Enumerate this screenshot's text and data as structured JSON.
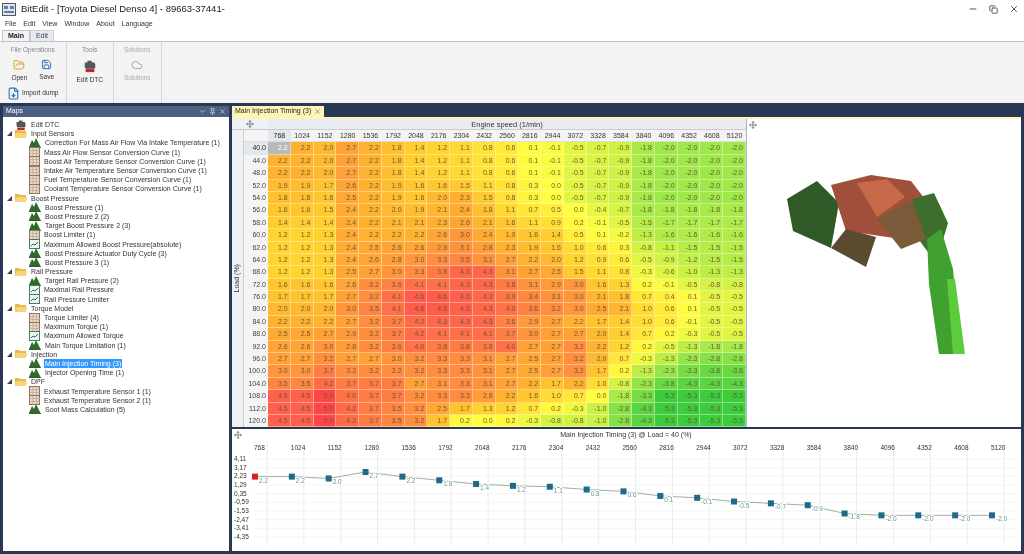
{
  "window": {
    "title": "BitEdit - [Toyota Diesel Denso 4] - 89663-37441-"
  },
  "menu": [
    "File",
    "Edit",
    "View",
    "Window",
    "About",
    "Language"
  ],
  "ribbon_tabs": [
    {
      "label": "Main",
      "selected": true
    },
    {
      "label": "Edit",
      "selected": false
    }
  ],
  "ribbon_groups": [
    {
      "title": "File Operations",
      "disabled": false,
      "buttons": [
        {
          "label": "Open",
          "kind": "open",
          "disabled": false
        },
        {
          "label": "Save",
          "kind": "save",
          "disabled": false
        }
      ],
      "wide_button": {
        "label": "Import dump",
        "kind": "import",
        "disabled": false
      }
    },
    {
      "title": "Tools",
      "disabled": false,
      "buttons": [
        {
          "label": "Edit DTC",
          "kind": "dtc",
          "disabled": false
        }
      ]
    },
    {
      "title": "Solutions",
      "disabled": true,
      "buttons": [
        {
          "label": "Solutions",
          "kind": "cloud",
          "disabled": true
        }
      ]
    }
  ],
  "maps_panel": {
    "title": "Maps",
    "tree": [
      {
        "label": "Edit DTC",
        "kind": "dtc",
        "selected": false
      },
      {
        "label": "Input Sensors",
        "kind": "folder",
        "expanded": true,
        "selected": false,
        "children": [
          {
            "label": "Correction For Mass Air Flow Via Intake Temperature (1)",
            "kind": "map3d",
            "selected": false
          },
          {
            "label": "Mass Air Flow Sensor Conversion Curve (1)",
            "kind": "table",
            "selected": false
          },
          {
            "label": "Boost Air Temperature Sensor Conversion Curve (1)",
            "kind": "table",
            "selected": false
          },
          {
            "label": "Intake Air Temperature Sensor Conversion Curve (1)",
            "kind": "table",
            "selected": false
          },
          {
            "label": "Fuel Temperature Sensor Conversion Curve (1)",
            "kind": "table",
            "selected": false
          },
          {
            "label": "Coolant Temperature Sensor Conversion Curve (1)",
            "kind": "table",
            "selected": false
          }
        ]
      },
      {
        "label": "Boost Pressure",
        "kind": "folder",
        "expanded": true,
        "selected": false,
        "children": [
          {
            "label": "Boost Pressure (1)",
            "kind": "map3d",
            "selected": false
          },
          {
            "label": "Boost Pressure 2 (2)",
            "kind": "map3d",
            "selected": false
          },
          {
            "label": "Target Boost Pressure 2 (3)",
            "kind": "map3d",
            "selected": false
          },
          {
            "label": "Boost Limiter (1)",
            "kind": "table",
            "selected": false
          },
          {
            "label": "Maximum Allowed Boost Pressure(absolute)",
            "kind": "curve",
            "selected": false
          },
          {
            "label": "Boost Pressure Actuator Duty Cycle (3)",
            "kind": "map3d",
            "selected": false
          },
          {
            "label": "Boost Pressure 3 (1)",
            "kind": "map3d",
            "selected": false
          }
        ]
      },
      {
        "label": "Rail Pressure",
        "kind": "folder",
        "expanded": true,
        "selected": false,
        "children": [
          {
            "label": "Target Rail Pressure (2)",
            "kind": "map3d",
            "selected": false
          },
          {
            "label": "Maximal Rail Pressure",
            "kind": "curve",
            "selected": false
          },
          {
            "label": "Rail Pressure Limiter",
            "kind": "curve",
            "selected": false
          }
        ]
      },
      {
        "label": "Torque Model",
        "kind": "folder",
        "expanded": true,
        "selected": false,
        "children": [
          {
            "label": "Torque Limiter (4)",
            "kind": "table",
            "selected": false
          },
          {
            "label": "Maximum Torque (1)",
            "kind": "table",
            "selected": false
          },
          {
            "label": "Maximum Allowed Torque",
            "kind": "curve",
            "selected": false
          },
          {
            "label": "Main Torque Limitation (1)",
            "kind": "map3d",
            "selected": false
          }
        ]
      },
      {
        "label": "Injection",
        "kind": "folder",
        "expanded": true,
        "selected": false,
        "children": [
          {
            "label": "Main Injection Timing (3)",
            "kind": "map3d",
            "selected": true
          },
          {
            "label": "Injector Opening Time (1)",
            "kind": "map3d",
            "selected": false
          }
        ]
      },
      {
        "label": "DPF",
        "kind": "folder",
        "expanded": true,
        "selected": false,
        "children": [
          {
            "label": "Exhaust Temperature Sensor 1 (1)",
            "kind": "table",
            "selected": false
          },
          {
            "label": "Exhaust Temperature Sensor 2 (1)",
            "kind": "table",
            "selected": false
          },
          {
            "label": "Soot Mass Calculation (5)",
            "kind": "map3d",
            "selected": false
          }
        ]
      }
    ]
  },
  "document_tabs": [
    {
      "label": "Main Injection Timing (3)",
      "selected": true
    }
  ],
  "table": {
    "x_title": "Engine speed (1/min)",
    "y_title": "Load (%)",
    "columns": [
      {
        "label": "768",
        "selected": true
      },
      {
        "label": "1024",
        "selected": false
      },
      {
        "label": "1152",
        "selected": false
      },
      {
        "label": "1280",
        "selected": false
      },
      {
        "label": "1536",
        "selected": false
      },
      {
        "label": "1792",
        "selected": false
      },
      {
        "label": "2048",
        "selected": false
      },
      {
        "label": "2176",
        "selected": false
      },
      {
        "label": "2304",
        "selected": false
      },
      {
        "label": "2432",
        "selected": false
      },
      {
        "label": "2560",
        "selected": false
      },
      {
        "label": "2816",
        "selected": false
      },
      {
        "label": "2944",
        "selected": false
      },
      {
        "label": "3072",
        "selected": false
      },
      {
        "label": "3328",
        "selected": false
      },
      {
        "label": "3584",
        "selected": false
      },
      {
        "label": "3840",
        "selected": false
      },
      {
        "label": "4096",
        "selected": false
      },
      {
        "label": "4352",
        "selected": false
      },
      {
        "label": "4608",
        "selected": false
      },
      {
        "label": "5120",
        "selected": false
      }
    ],
    "rows": [
      {
        "label": "40.0",
        "selected": true,
        "cells": [
          "2.2",
          "2.2",
          "2.0",
          "2.7",
          "2.2",
          "1.8",
          "1.4",
          "1.2",
          "1.1",
          "0.8",
          "0.6",
          "0.1",
          "-0.1",
          "-0.5",
          "-0.7",
          "-0.9",
          "-1.8",
          "-2.0",
          "-2.0",
          "-2.0",
          "-2.0"
        ]
      },
      {
        "label": "44.0",
        "selected": false,
        "cells": [
          "2.2",
          "2.2",
          "2.0",
          "2.7",
          "2.2",
          "1.8",
          "1.4",
          "1.2",
          "1.1",
          "0.8",
          "0.6",
          "0.1",
          "-0.1",
          "-0.5",
          "-0.7",
          "-0.9",
          "-1.8",
          "-2.0",
          "-2.0",
          "-2.0",
          "-2.0"
        ]
      },
      {
        "label": "48.0",
        "selected": false,
        "cells": [
          "2.2",
          "2.2",
          "2.0",
          "2.7",
          "2.2",
          "1.8",
          "1.4",
          "1.2",
          "1.1",
          "0.8",
          "0.6",
          "0.1",
          "-0.1",
          "-0.5",
          "-0.7",
          "-0.9",
          "-1.8",
          "-2.0",
          "-2.0",
          "-2.0",
          "-2.0"
        ]
      },
      {
        "label": "52.0",
        "selected": false,
        "cells": [
          "1.9",
          "1.9",
          "1.7",
          "2.6",
          "2.2",
          "1.9",
          "1.6",
          "1.6",
          "1.5",
          "1.1",
          "0.8",
          "0.3",
          "0.0",
          "-0.5",
          "-0.7",
          "-0.9",
          "-1.8",
          "-2.0",
          "-2.0",
          "-2.0",
          "-2.0"
        ]
      },
      {
        "label": "54.0",
        "selected": false,
        "cells": [
          "1.8",
          "1.8",
          "1.6",
          "2.5",
          "2.2",
          "1.9",
          "1.6",
          "2.0",
          "2.3",
          "1.5",
          "0.8",
          "0.3",
          "0.0",
          "-0.5",
          "-0.7",
          "-0.9",
          "-1.8",
          "-2.0",
          "-2.0",
          "-2.0",
          "-2.0"
        ]
      },
      {
        "label": "56.0",
        "selected": false,
        "cells": [
          "1.6",
          "1.6",
          "1.5",
          "2.4",
          "2.2",
          "2.0",
          "1.9",
          "2.1",
          "2.4",
          "1.8",
          "1.1",
          "0.7",
          "0.5",
          "0.0",
          "-0.4",
          "-0.7",
          "-1.8",
          "-1.8",
          "-1.8",
          "-1.8",
          "-1.8"
        ]
      },
      {
        "label": "58.0",
        "selected": false,
        "cells": [
          "1.4",
          "1.4",
          "1.4",
          "2.4",
          "2.2",
          "2.1",
          "2.1",
          "2.3",
          "2.6",
          "2.1",
          "1.6",
          "1.1",
          "0.9",
          "0.2",
          "-0.1",
          "-0.5",
          "-1.5",
          "-1.7",
          "-1.7",
          "-1.7",
          "-1.7"
        ]
      },
      {
        "label": "60.0",
        "selected": false,
        "cells": [
          "1.2",
          "1.2",
          "1.3",
          "2.4",
          "2.2",
          "2.2",
          "2.2",
          "2.6",
          "3.0",
          "2.4",
          "1.9",
          "1.6",
          "1.4",
          "0.5",
          "0.1",
          "-0.2",
          "-1.3",
          "-1.6",
          "-1.6",
          "-1.6",
          "-1.6"
        ]
      },
      {
        "label": "62.0",
        "selected": false,
        "cells": [
          "1.2",
          "1.2",
          "1.3",
          "2.4",
          "2.5",
          "2.6",
          "2.6",
          "2.9",
          "3.1",
          "2.8",
          "2.3",
          "1.9",
          "1.6",
          "1.0",
          "0.6",
          "0.3",
          "-0.8",
          "-1.1",
          "-1.5",
          "-1.5",
          "-1.5"
        ]
      },
      {
        "label": "64.0",
        "selected": false,
        "cells": [
          "1.2",
          "1.2",
          "1.3",
          "2.4",
          "2.6",
          "2.8",
          "3.0",
          "3.3",
          "3.5",
          "3.1",
          "2.7",
          "2.2",
          "2.0",
          "1.2",
          "0.9",
          "0.6",
          "-0.5",
          "-0.9",
          "-1.2",
          "-1.5",
          "-1.5"
        ]
      },
      {
        "label": "68.0",
        "selected": false,
        "cells": [
          "1.2",
          "1.2",
          "1.3",
          "2.5",
          "2.7",
          "3.0",
          "3.3",
          "3.8",
          "4.3",
          "4.3",
          "3.1",
          "2.7",
          "2.5",
          "1.5",
          "1.1",
          "0.8",
          "-0.3",
          "-0.6",
          "-1.0",
          "-1.3",
          "-1.3"
        ]
      },
      {
        "label": "72.0",
        "selected": false,
        "cells": [
          "1.6",
          "1.6",
          "1.6",
          "2.6",
          "3.2",
          "3.6",
          "4.1",
          "4.1",
          "4.3",
          "4.3",
          "3.8",
          "3.1",
          "2.9",
          "3.0",
          "1.6",
          "1.3",
          "0.2",
          "-0.1",
          "-0.5",
          "-0.8",
          "-0.8"
        ]
      },
      {
        "label": "76.0",
        "selected": false,
        "cells": [
          "1.7",
          "1.7",
          "1.7",
          "2.7",
          "3.2",
          "4.1",
          "4.6",
          "4.6",
          "4.5",
          "4.3",
          "3.9",
          "3.4",
          "3.1",
          "3.0",
          "2.1",
          "1.8",
          "0.7",
          "0.4",
          "0.1",
          "-0.5",
          "-0.5"
        ]
      },
      {
        "label": "80.0",
        "selected": false,
        "cells": [
          "2.0",
          "2.0",
          "2.0",
          "3.0",
          "3.5",
          "4.1",
          "4.6",
          "4.6",
          "4.5",
          "4.3",
          "4.0",
          "3.6",
          "3.2",
          "3.0",
          "2.5",
          "2.1",
          "1.0",
          "0.6",
          "0.1",
          "-0.5",
          "-0.5"
        ]
      },
      {
        "label": "84.0",
        "selected": false,
        "cells": [
          "2.2",
          "2.2",
          "2.2",
          "2.7",
          "3.2",
          "3.7",
          "4.2",
          "4.3",
          "4.3",
          "4.3",
          "3.6",
          "2.9",
          "2.7",
          "2.2",
          "1.7",
          "1.4",
          "1.0",
          "0.6",
          "-0.1",
          "-0.5",
          "-0.5"
        ]
      },
      {
        "label": "88.0",
        "selected": false,
        "cells": [
          "2.5",
          "2.5",
          "2.7",
          "2.9",
          "3.2",
          "3.7",
          "4.2",
          "4.1",
          "4.1",
          "4.1",
          "3.7",
          "3.0",
          "2.7",
          "2.7",
          "2.0",
          "1.4",
          "0.7",
          "0.2",
          "-0.3",
          "-0.5",
          "-0.5"
        ]
      },
      {
        "label": "92.0",
        "selected": false,
        "cells": [
          "2.6",
          "2.6",
          "3.0",
          "2.8",
          "3.2",
          "3.6",
          "4.0",
          "3.8",
          "3.8",
          "3.8",
          "4.0",
          "2.7",
          "2.7",
          "3.2",
          "2.2",
          "1.2",
          "0.2",
          "-0.5",
          "-1.3",
          "-1.8",
          "-1.8"
        ]
      },
      {
        "label": "96.0",
        "selected": false,
        "cells": [
          "2.7",
          "2.7",
          "3.2",
          "2.7",
          "2.7",
          "3.0",
          "3.2",
          "3.3",
          "3.3",
          "3.1",
          "2.7",
          "2.5",
          "2.7",
          "3.2",
          "2.0",
          "0.7",
          "-0.3",
          "-1.3",
          "-2.3",
          "-2.8",
          "-2.8"
        ]
      },
      {
        "label": "100.0",
        "selected": false,
        "cells": [
          "3.0",
          "3.0",
          "3.7",
          "3.2",
          "3.2",
          "3.2",
          "3.2",
          "3.3",
          "3.3",
          "3.1",
          "2.7",
          "2.5",
          "2.7",
          "3.2",
          "1.7",
          "0.2",
          "-1.3",
          "-2.3",
          "-3.3",
          "-3.8",
          "-3.8"
        ]
      },
      {
        "label": "104.0",
        "selected": false,
        "cells": [
          "3.5",
          "3.5",
          "4.2",
          "3.7",
          "3.7",
          "3.7",
          "2.7",
          "3.1",
          "3.3",
          "3.1",
          "2.7",
          "2.2",
          "1.7",
          "2.2",
          "1.0",
          "-0.8",
          "-2.3",
          "-3.8",
          "-4.3",
          "-4.3",
          "-4.3"
        ]
      },
      {
        "label": "108.0",
        "selected": false,
        "cells": [
          "4.5",
          "4.5",
          "5.0",
          "4.0",
          "3.7",
          "3.7",
          "3.2",
          "3.3",
          "3.3",
          "2.8",
          "2.2",
          "1.6",
          "1.0",
          "0.7",
          "0.0",
          "-1.8",
          "-3.3",
          "-5.3",
          "-5.3",
          "-5.3",
          "-5.3"
        ]
      },
      {
        "label": "112.0",
        "selected": false,
        "cells": [
          "4.5",
          "4.5",
          "5.0",
          "4.2",
          "3.7",
          "3.5",
          "3.2",
          "2.5",
          "1.7",
          "1.3",
          "1.2",
          "0.7",
          "0.2",
          "-0.3",
          "-1.0",
          "-2.8",
          "-4.3",
          "-5.3",
          "-5.3",
          "-5.3",
          "-5.3"
        ]
      },
      {
        "label": "120.0",
        "selected": false,
        "cells": [
          "4.5",
          "4.5",
          "5.0",
          "4.2",
          "3.7",
          "3.5",
          "3.2",
          "1.7",
          "0.2",
          "0.0",
          "0.2",
          "-0.3",
          "-0.8",
          "-0.8",
          "-1.0",
          "-2.8",
          "-4.3",
          "-5.3",
          "-5.3",
          "-5.3",
          "-5.3"
        ]
      }
    ]
  },
  "graph": {
    "chart_data": {
      "type": "line",
      "title": "Main Injection Timing (3) @ Load = 40 (%)",
      "categories": [
        "768",
        "1024",
        "1152",
        "1280",
        "1536",
        "1792",
        "2048",
        "2176",
        "2304",
        "2432",
        "2560",
        "2816",
        "2944",
        "3072",
        "3328",
        "3584",
        "3840",
        "4096",
        "4352",
        "4608",
        "5120"
      ],
      "values": [
        2.2,
        2.2,
        2.0,
        2.7,
        2.2,
        1.8,
        1.4,
        1.2,
        1.1,
        0.8,
        0.6,
        0.1,
        -0.1,
        -0.5,
        -0.7,
        -0.9,
        -1.8,
        -2.0,
        -2.0,
        -2.0,
        -2.0
      ],
      "yticks": [
        {
          "value": 4.11,
          "label": "4,11"
        },
        {
          "value": 3.17,
          "label": "3,17"
        },
        {
          "value": 2.23,
          "label": "2,23"
        },
        {
          "value": 1.29,
          "label": "1,29"
        },
        {
          "value": 0.35,
          "label": "0,35"
        },
        {
          "value": -0.59,
          "label": "-0,59"
        },
        {
          "value": -1.53,
          "label": "-1,53"
        },
        {
          "value": -2.47,
          "label": "-2,47"
        },
        {
          "value": -3.41,
          "label": "-3,41"
        },
        {
          "value": -4.35,
          "label": "-4,35"
        }
      ],
      "ylim": [
        -4.35,
        4.11
      ],
      "grid": true,
      "marker": "square",
      "value_labels": [
        "2.2",
        "2.2",
        "2.0",
        "2.7",
        "2.2",
        "1.8",
        "1.4",
        "1.2",
        "1.1",
        "0.8",
        "0.6",
        "0.1",
        "-0.1",
        "-0.5",
        "-0.7",
        "-0.9",
        "-1.8",
        "-2.0",
        "-2.0",
        "-2.0",
        "-2.0"
      ]
    }
  }
}
